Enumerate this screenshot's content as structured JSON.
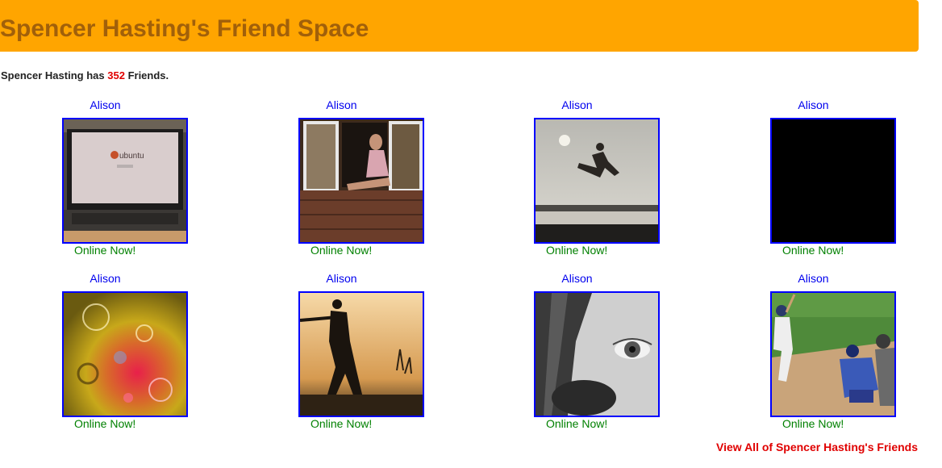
{
  "header": {
    "title": "Spencer Hasting's Friend Space"
  },
  "summary": {
    "prefix": "Spencer Hasting has",
    "count": "352",
    "suffix": "Friends."
  },
  "friends": [
    {
      "name": "Alison",
      "status": "Online Now!",
      "photo": "laptop-ubuntu-photo"
    },
    {
      "name": "Alison",
      "status": "Online Now!",
      "photo": "woman-window-photo"
    },
    {
      "name": "Alison",
      "status": "Online Now!",
      "photo": "jumping-kick-photo"
    },
    {
      "name": "Alison",
      "status": "Online Now!",
      "photo": "black-photo"
    },
    {
      "name": "Alison",
      "status": "Online Now!",
      "photo": "colorful-bubbles-photo"
    },
    {
      "name": "Alison",
      "status": "Online Now!",
      "photo": "cricket-silhouette-photo"
    },
    {
      "name": "Alison",
      "status": "Online Now!",
      "photo": "eye-closeup-photo"
    },
    {
      "name": "Alison",
      "status": "Online Now!",
      "photo": "baseball-photo"
    }
  ],
  "photo_text": {
    "ubuntu_logo": "ubuntu"
  },
  "footer": {
    "view_all": "View All of Spencer Hasting's Friends"
  },
  "colors": {
    "header_bg": "#ffa500",
    "title": "#a1600a",
    "link": "#0000ee",
    "online": "#008000",
    "accent_red": "#e00000",
    "photo_border": "#0000ff"
  }
}
